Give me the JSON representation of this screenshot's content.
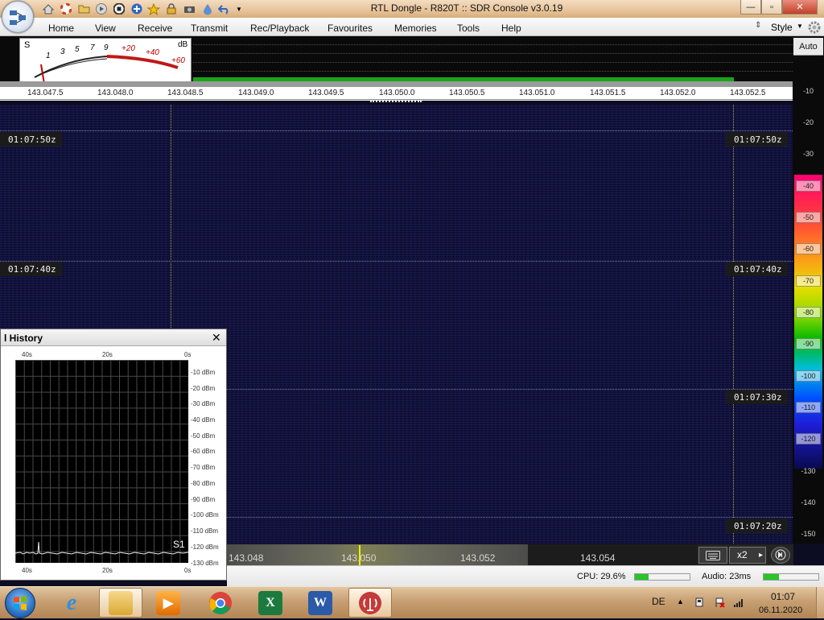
{
  "window": {
    "title": "RTL Dongle - R820T :: SDR Console v3.0.19",
    "controls": {
      "minimize_glyph": "—",
      "maximize_glyph": "▫",
      "close_glyph": "✕"
    }
  },
  "quick_access": [
    "home-icon",
    "lifebuoy-icon",
    "folder-icon",
    "play-icon",
    "stop-icon",
    "add-icon",
    "favourite-star-icon",
    "lock-icon",
    "camera-icon",
    "droplet-icon",
    "undo-icon",
    "dropdown-icon"
  ],
  "menu": {
    "items": [
      "Home",
      "View",
      "Receive",
      "Transmit",
      "Rec/Playback",
      "Favourites",
      "Memories",
      "Tools",
      "Help"
    ],
    "style_label": "Style"
  },
  "smeter": {
    "s_label": "S",
    "db_label": "dB",
    "s_scale": [
      "1",
      "3",
      "5",
      "7",
      "9"
    ],
    "db_scale": [
      "+20",
      "+40",
      "+60"
    ]
  },
  "frequency_axis": [
    "143.047.5",
    "143.048.0",
    "143.048.5",
    "143.049.0",
    "143.049.5",
    "143.050.0",
    "143.050.5",
    "143.051.0",
    "143.051.5",
    "143.052.0",
    "143.052.5"
  ],
  "waterfall": {
    "timestamps": [
      "01:07:50z",
      "01:07:40z",
      "01:07:30z",
      "01:07:20z"
    ]
  },
  "level_scale": {
    "auto_label": "Auto",
    "labels": [
      "-10",
      "-20",
      "-30",
      "-40",
      "-50",
      "-60",
      "-70",
      "-80",
      "-90",
      "-100",
      "-110",
      "-120",
      "-130",
      "-140",
      "-150"
    ]
  },
  "signal_history": {
    "title": "l History",
    "close_glyph": "✕",
    "x_labels": [
      "40s",
      "20s",
      "0s"
    ],
    "y_labels": [
      "-10 dBm",
      "-20 dBm",
      "-30 dBm",
      "-40 dBm",
      "-50 dBm",
      "-60 dBm",
      "-70 dBm",
      "-80 dBm",
      "-90 dBm",
      "-100 dBm",
      "-110 dBm",
      "-120 dBm",
      "-130 dBm"
    ],
    "s_reading": "S1"
  },
  "tuning_strip": {
    "labels": [
      "143.048",
      "143.050",
      "143.052",
      "143.054"
    ],
    "zoom_label": "x2",
    "play_glyph": "▸"
  },
  "status": {
    "cpu_text": "CPU: 29.6%",
    "cpu_level": 0.25,
    "audio_text": "Audio: 23ms",
    "audio_level": 0.28
  },
  "taskbar": {
    "apps": [
      "internet-explorer",
      "file-explorer",
      "media-player",
      "chrome",
      "excel",
      "word",
      "sdr-console"
    ],
    "language": "DE",
    "time": "01:07",
    "date": "06.11.2020"
  },
  "colors": {
    "waterfall_bg": "#0e0e30",
    "signal_green": "#19a519",
    "tune_cursor": "#eded00"
  }
}
